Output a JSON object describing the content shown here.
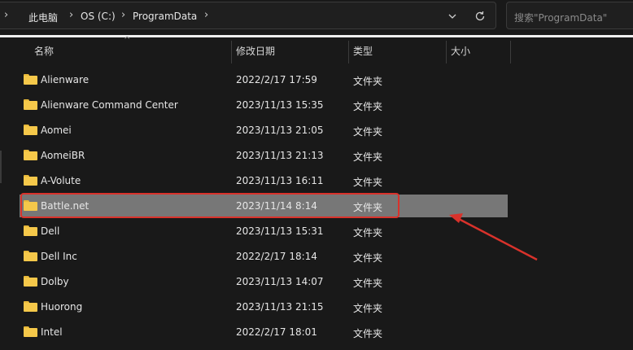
{
  "breadcrumb": {
    "items": [
      "此电脑",
      "OS (C:)",
      "ProgramData"
    ]
  },
  "search": {
    "placeholder": "搜索\"ProgramData\""
  },
  "columns": {
    "name": "名称",
    "modified": "修改日期",
    "type": "类型",
    "size": "大小"
  },
  "files": [
    {
      "name": "Alienware",
      "modified": "2022/2/17 17:59",
      "type": "文件夹",
      "selected": false
    },
    {
      "name": "Alienware Command Center",
      "modified": "2023/11/13 15:35",
      "type": "文件夹",
      "selected": false
    },
    {
      "name": "Aomei",
      "modified": "2023/11/13 21:05",
      "type": "文件夹",
      "selected": false
    },
    {
      "name": "AomeiBR",
      "modified": "2023/11/13 21:13",
      "type": "文件夹",
      "selected": false
    },
    {
      "name": "A-Volute",
      "modified": "2023/11/13 16:11",
      "type": "文件夹",
      "selected": false
    },
    {
      "name": "Battle.net",
      "modified": "2023/11/14 8:14",
      "type": "文件夹",
      "selected": true
    },
    {
      "name": "Dell",
      "modified": "2023/11/13 15:31",
      "type": "文件夹",
      "selected": false
    },
    {
      "name": "Dell Inc",
      "modified": "2022/2/17 18:14",
      "type": "文件夹",
      "selected": false
    },
    {
      "name": "Dolby",
      "modified": "2023/11/13 14:07",
      "type": "文件夹",
      "selected": false
    },
    {
      "name": "Huorong",
      "modified": "2023/11/13 21:15",
      "type": "文件夹",
      "selected": false
    },
    {
      "name": "Intel",
      "modified": "2022/2/17 18:01",
      "type": "文件夹",
      "selected": false
    }
  ],
  "colors": {
    "selection": "#777777",
    "annotation": "#d9322b",
    "folder": "#f5c84a"
  }
}
